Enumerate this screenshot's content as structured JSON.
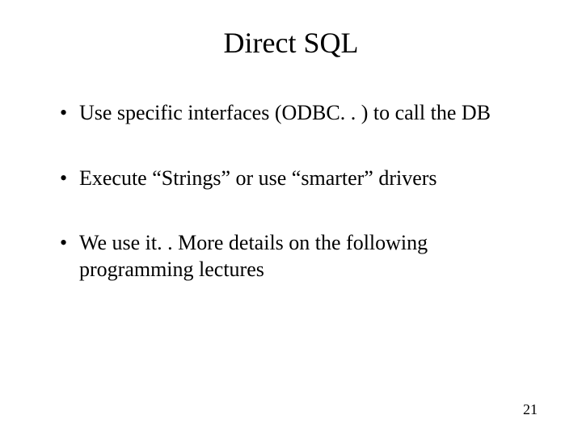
{
  "slide": {
    "title": "Direct SQL",
    "bullets": [
      "Use specific interfaces (ODBC. . ) to call the DB",
      "Execute “Strings” or use “smarter” drivers",
      "We use it. . More details on the following programming lectures"
    ],
    "page_number": "21"
  }
}
